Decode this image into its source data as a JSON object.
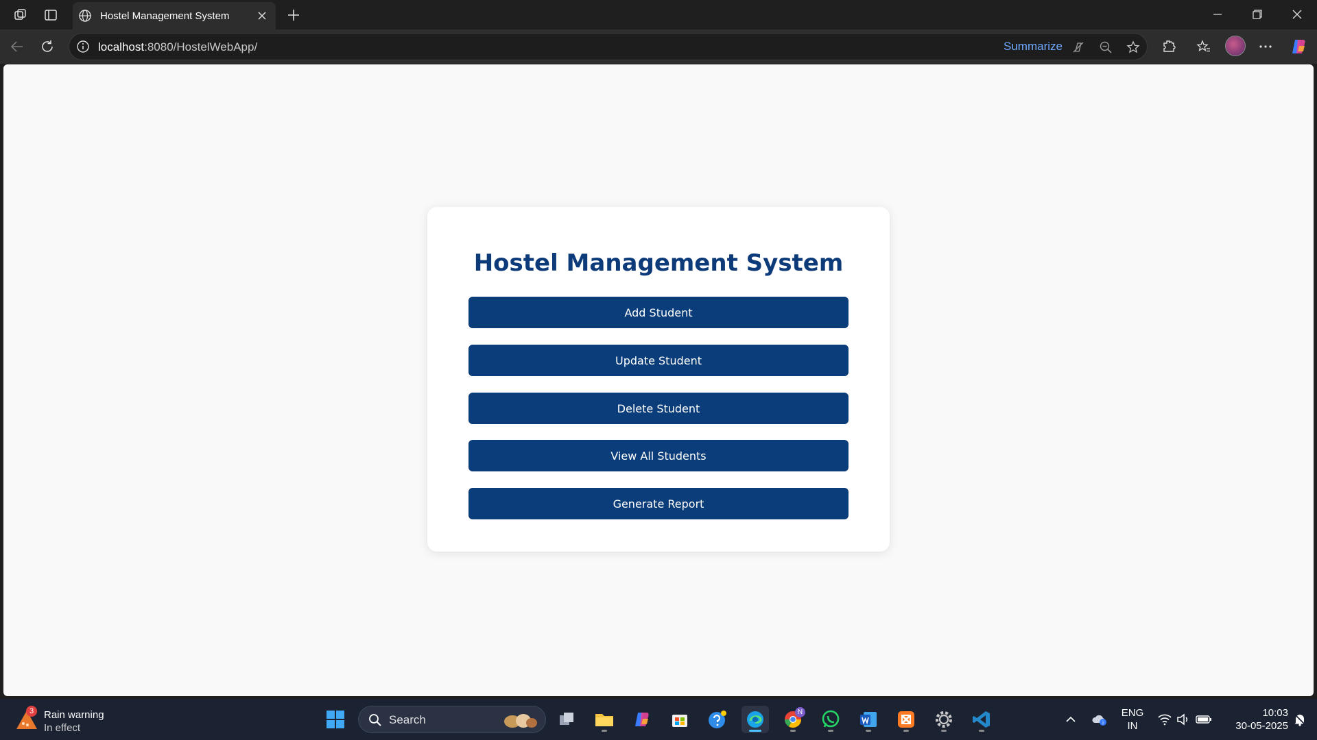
{
  "browser": {
    "tab_title": "Hostel Management System",
    "url_host": "localhost",
    "url_path": ":8080/HostelWebApp/",
    "summarize_label": "Summarize"
  },
  "page": {
    "heading": "Hostel Management System",
    "buttons": [
      {
        "label": "Add Student"
      },
      {
        "label": "Update Student"
      },
      {
        "label": "Delete Student"
      },
      {
        "label": "View All Students"
      },
      {
        "label": "Generate Report"
      }
    ]
  },
  "taskbar": {
    "weather_badge": "3",
    "weather_title": "Rain warning",
    "weather_subtitle": "In effect",
    "search_label": "Search",
    "language_line1": "ENG",
    "language_line2": "IN",
    "time": "10:03",
    "date": "30-05-2025",
    "chrome_badge": "N"
  },
  "colors": {
    "primary": "#0b3d7a",
    "heading": "#0d3b7a",
    "page_bg": "#f9f9f9",
    "taskbar_bg": "#1b2333"
  }
}
